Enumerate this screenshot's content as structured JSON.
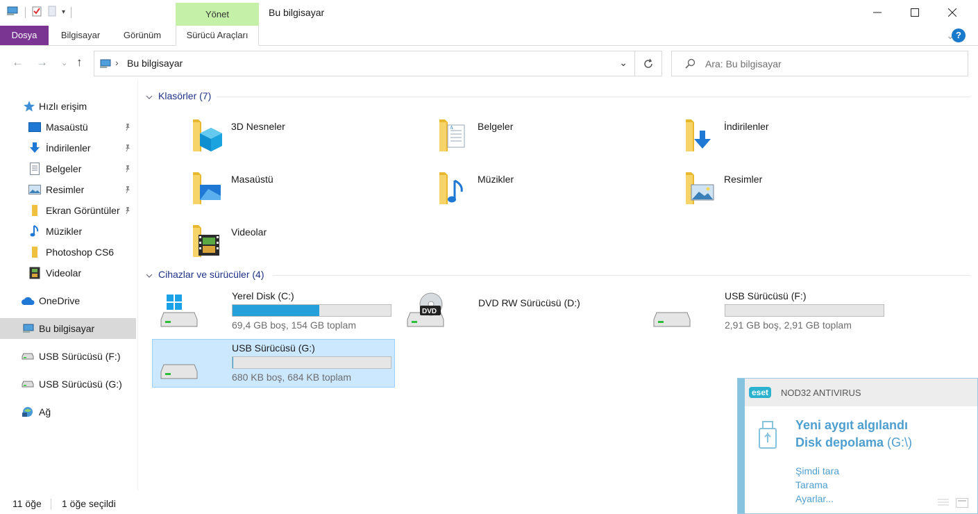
{
  "window": {
    "title": "Bu bilgisayar",
    "context_tab_group": "Yönet"
  },
  "ribbon": {
    "tabs": [
      {
        "label": "Dosya"
      },
      {
        "label": "Bilgisayar"
      },
      {
        "label": "Görünüm"
      },
      {
        "label": "Sürücü Araçları"
      }
    ],
    "help_label": "?"
  },
  "address_bar": {
    "path": "Bu bilgisayar"
  },
  "search": {
    "placeholder": "Ara: Bu bilgisayar"
  },
  "nav_pane": {
    "quick_access": "Hızlı erişim",
    "quick_items": [
      {
        "label": "Masaüstü",
        "icon": "desktop-icon",
        "pinned": true
      },
      {
        "label": "İndirilenler",
        "icon": "download-icon",
        "pinned": true
      },
      {
        "label": "Belgeler",
        "icon": "documents-icon",
        "pinned": true
      },
      {
        "label": "Resimler",
        "icon": "pictures-icon",
        "pinned": true
      },
      {
        "label": "Ekran Görüntüler",
        "icon": "folder-icon",
        "pinned": true
      },
      {
        "label": "Müzikler",
        "icon": "music-icon",
        "pinned": false
      },
      {
        "label": "Photoshop CS6",
        "icon": "folder-icon",
        "pinned": false
      },
      {
        "label": "Videolar",
        "icon": "video-icon",
        "pinned": false
      }
    ],
    "onedrive": "OneDrive",
    "this_pc": "Bu bilgisayar",
    "usb_f": "USB Sürücüsü (F:)",
    "usb_g": "USB Sürücüsü (G:)",
    "network": "Ağ"
  },
  "folders_group": {
    "header": "Klasörler (7)",
    "items": [
      {
        "name": "3D Nesneler",
        "icon": "3d-objects-icon"
      },
      {
        "name": "Belgeler",
        "icon": "documents-icon"
      },
      {
        "name": "İndirilenler",
        "icon": "download-icon"
      },
      {
        "name": "Masaüstü",
        "icon": "desktop-icon"
      },
      {
        "name": "Müzikler",
        "icon": "music-icon"
      },
      {
        "name": "Resimler",
        "icon": "pictures-icon"
      },
      {
        "name": "Videolar",
        "icon": "video-icon"
      }
    ]
  },
  "devices_group": {
    "header": "Cihazlar ve sürücüler (4)",
    "drives": [
      {
        "name": "Yerel Disk (C:)",
        "info": "69,4 GB boş, 154 GB toplam",
        "used_fraction": 0.55,
        "icon": "windows-drive-icon"
      },
      {
        "name": "DVD RW Sürücüsü (D:)",
        "info": "",
        "icon": "dvd-drive-icon"
      },
      {
        "name": "USB Sürücüsü (F:)",
        "info": "2,91 GB boş, 2,91 GB toplam",
        "used_fraction": 0.0,
        "icon": "usb-drive-icon"
      },
      {
        "name": "USB Sürücüsü (G:)",
        "info": "680 KB boş, 684 KB toplam",
        "used_fraction": 0.006,
        "icon": "usb-drive-icon"
      }
    ]
  },
  "status": {
    "item_count": "11 öğe",
    "selected": "1 öğe seçildi"
  },
  "eset": {
    "logo": "eset",
    "product": "NOD32 ANTIVIRUS",
    "title": "Yeni aygıt algılandı",
    "device_bold": "Disk depolama",
    "device_path": " (G:\\)",
    "actions": [
      "Şimdi tara",
      "Tarama",
      "Ayarlar..."
    ]
  },
  "colors": {
    "file_tab": "#7a3592",
    "manage_tab": "#c5f0a7",
    "selection": "#cce8ff",
    "progress": "#26a0da",
    "eset_accent": "#4e9fd0"
  }
}
